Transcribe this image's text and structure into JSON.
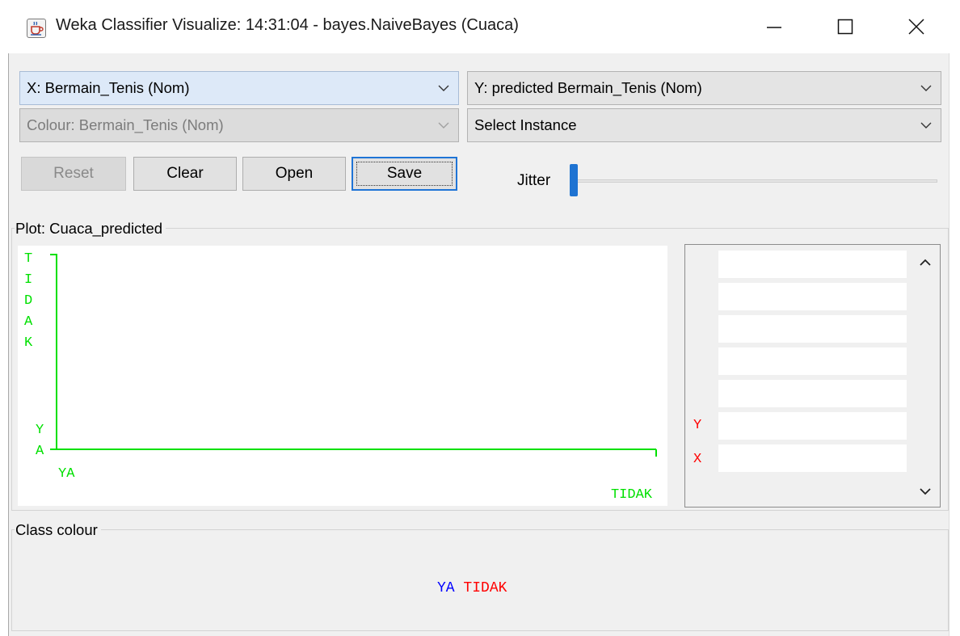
{
  "window": {
    "title": "Weka Classifier Visualize: 14:31:04 - bayes.NaiveBayes (Cuaca)",
    "icon": "java-coffee-icon"
  },
  "controls": {
    "x_axis": "X: Bermain_Tenis (Nom)",
    "y_axis": "Y: predicted Bermain_Tenis (Nom)",
    "colour": "Colour: Bermain_Tenis (Nom)",
    "select_instance": "Select Instance"
  },
  "buttons": {
    "reset": "Reset",
    "clear": "Clear",
    "open": "Open",
    "save": "Save"
  },
  "jitter": {
    "label": "Jitter",
    "value": 0
  },
  "plot": {
    "group_title": "Plot: Cuaca_predicted",
    "y_axis_top": "TIDAK",
    "y_axis_bottom": "YA",
    "x_axis_left": "YA",
    "x_axis_right": "TIDAK",
    "axis_color": "#00e000"
  },
  "attribute_panel": {
    "y_label": "Y",
    "x_label": "X",
    "bar_count": 7
  },
  "class_colour": {
    "group_title": "Class colour",
    "values": [
      {
        "label": "YA",
        "color": "#0000ff"
      },
      {
        "label": "TIDAK",
        "color": "#ff0000"
      }
    ]
  }
}
